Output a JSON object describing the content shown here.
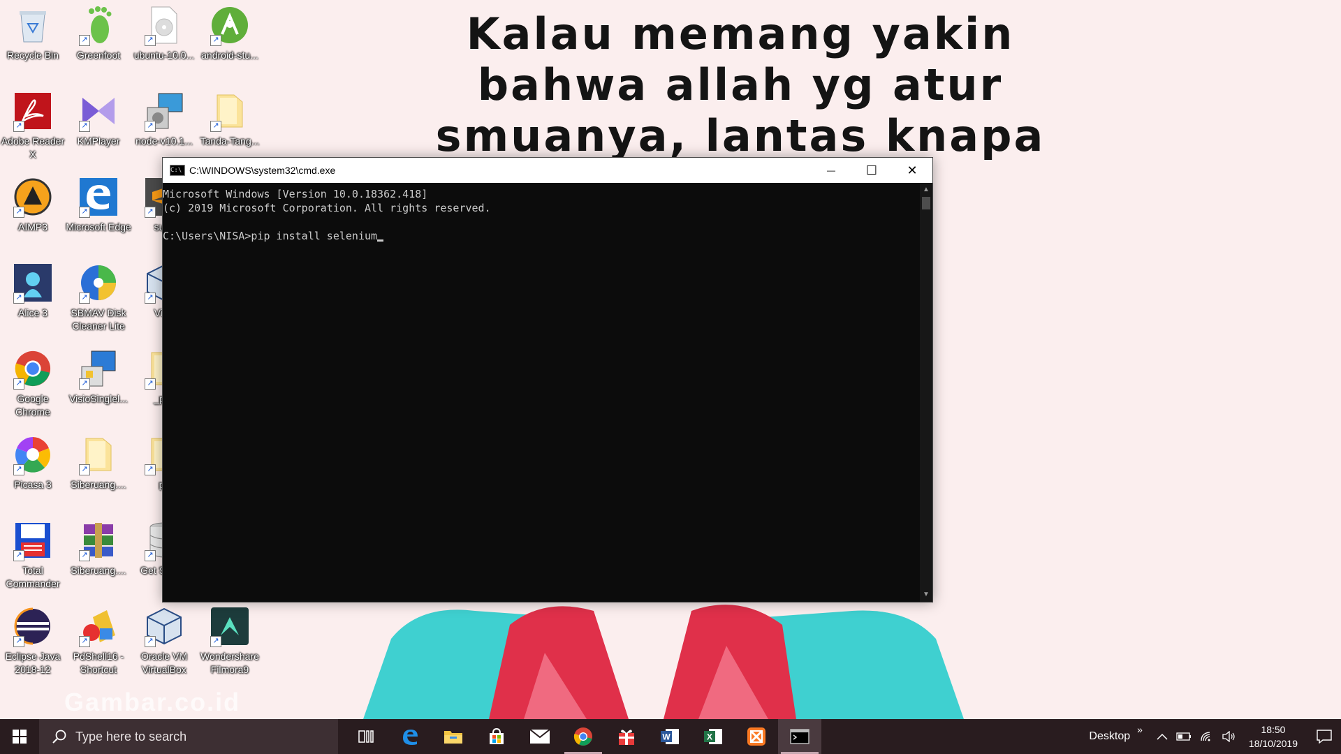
{
  "wallpaper": {
    "text": "Kalau memang yakin\nbahwa allah yg atur\nsmuanya, lantas knapa\n              ejar\n              cinta\n          ?",
    "watermark": "Gambar.co.id"
  },
  "desktop_icons": [
    {
      "label": "Recycle Bin",
      "icon": "recycle-bin-icon"
    },
    {
      "label": "Greenfoot",
      "icon": "greenfoot-icon"
    },
    {
      "label": "ubuntu-10.0...",
      "icon": "disc-image-icon"
    },
    {
      "label": "android-stu...",
      "icon": "android-studio-icon"
    },
    {
      "label": "Adobe Reader X",
      "icon": "adobe-reader-icon"
    },
    {
      "label": "KMPlayer",
      "icon": "kmplayer-icon"
    },
    {
      "label": "node-v10.1...",
      "icon": "installer-icon"
    },
    {
      "label": "Tanda-Tang...",
      "icon": "folder-icon"
    },
    {
      "label": "AIMP3",
      "icon": "aimp-icon"
    },
    {
      "label": "Microsoft Edge",
      "icon": "edge-icon"
    },
    {
      "label": "subli",
      "icon": "sublime-icon"
    },
    {
      "label": "Alice 3",
      "icon": "alice-icon"
    },
    {
      "label": "SBMAV Disk Cleaner Lite",
      "icon": "disk-cleaner-icon"
    },
    {
      "label": "Virtu",
      "icon": "virtualbox-icon"
    },
    {
      "label": "Google Chrome",
      "icon": "chrome-icon"
    },
    {
      "label": "VisioSinglel...",
      "icon": "visio-installer-icon"
    },
    {
      "label": "_pyc",
      "icon": "folder-icon"
    },
    {
      "label": "Picasa 3",
      "icon": "picasa-icon"
    },
    {
      "label": "Siberuang....",
      "icon": "folder-icon"
    },
    {
      "label": "py",
      "icon": "folder-icon"
    },
    {
      "label": "Total Commander",
      "icon": "total-commander-icon"
    },
    {
      "label": "Siberuang....",
      "icon": "winrar-archive-icon"
    },
    {
      "label": "Get S With",
      "icon": "database-icon"
    },
    {
      "label": "Eclipse Java 2018-12",
      "icon": "eclipse-icon"
    },
    {
      "label": "PdShell16 - Shortcut",
      "icon": "pdshell-icon"
    },
    {
      "label": "Oracle VM VirtualBox",
      "icon": "virtualbox-icon"
    },
    {
      "label": "Wondershare Filmora9",
      "icon": "filmora-icon"
    }
  ],
  "cmd": {
    "title": "C:\\WINDOWS\\system32\\cmd.exe",
    "icon_text": "C:\\",
    "lines": [
      "Microsoft Windows [Version 10.0.18362.418]",
      "(c) 2019 Microsoft Corporation. All rights reserved.",
      "",
      "C:\\Users\\NISA>pip install selenium"
    ],
    "minimize_glyph": "—",
    "maximize_glyph": "☐",
    "close_glyph": "✕",
    "scroll_up_glyph": "▲",
    "scroll_down_glyph": "▼"
  },
  "taskbar": {
    "search_placeholder": "Type here to search",
    "apps": [
      {
        "name": "task-view-icon",
        "active": false
      },
      {
        "name": "edge-icon",
        "active": false
      },
      {
        "name": "file-explorer-icon",
        "active": false
      },
      {
        "name": "store-icon",
        "active": false
      },
      {
        "name": "mail-icon",
        "active": false
      },
      {
        "name": "chrome-icon",
        "active": false,
        "running": true
      },
      {
        "name": "gift-icon",
        "active": false
      },
      {
        "name": "word-icon",
        "active": false
      },
      {
        "name": "excel-icon",
        "active": false
      },
      {
        "name": "xampp-icon",
        "active": false
      },
      {
        "name": "cmd-icon",
        "active": true
      }
    ],
    "desktop_label": "Desktop",
    "chevron": "»",
    "time": "18:50",
    "date": "18/10/2019"
  },
  "colors": {
    "taskbar": "#291c1f",
    "cmd_background": "#0c0c0c",
    "cmd_text": "#cccccc",
    "wallpaper_bg": "#fbeeee"
  }
}
